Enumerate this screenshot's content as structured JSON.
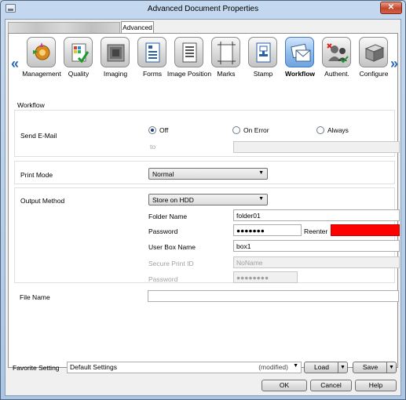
{
  "window": {
    "title": "Advanced Document Properties",
    "close_label": "✕"
  },
  "tabs": {
    "advanced_label": "Advanced"
  },
  "toolbar": {
    "items": [
      {
        "label": "Management",
        "icon": "management-gear-icon"
      },
      {
        "label": "Quality",
        "icon": "quality-icon"
      },
      {
        "label": "Imaging",
        "icon": "imaging-icon"
      },
      {
        "label": "Forms",
        "icon": "forms-icon"
      },
      {
        "label": "Image Position",
        "icon": "image-position-icon"
      },
      {
        "label": "Marks",
        "icon": "marks-icon"
      },
      {
        "label": "Stamp",
        "icon": "stamp-icon"
      },
      {
        "label": "Workflow",
        "icon": "workflow-icon",
        "active": true
      },
      {
        "label": "Authent.",
        "icon": "authentication-icon"
      },
      {
        "label": "Configure",
        "icon": "configure-icon"
      }
    ],
    "prev_glyph": "«",
    "next_glyph": "»"
  },
  "workflow": {
    "section_title": "Workflow",
    "send_email": {
      "label": "Send E-Mail",
      "options": [
        "Off",
        "On Error",
        "Always"
      ],
      "selected": "Off",
      "to_label": "to",
      "to_value": ""
    },
    "print_mode": {
      "label": "Print Mode",
      "value": "Normal"
    },
    "output_method": {
      "label": "Output Method",
      "value": "Store on HDD",
      "folder_name_label": "Folder Name",
      "folder_name_value": "folder01",
      "password_label": "Password",
      "password_value": "●●●●●●●",
      "reenter_label": "Reenter",
      "user_box_label": "User Box Name",
      "user_box_value": "box1",
      "secure_print_id_label": "Secure Print ID",
      "secure_print_id_value": "NoName",
      "secure_password_label": "Password",
      "secure_password_value": "●●●●●●●●"
    },
    "file_name": {
      "label": "File Name",
      "value": ""
    }
  },
  "favorite": {
    "label": "Favorite Setting",
    "value": "Default Settings",
    "modified_text": "(modified)",
    "load_label": "Load",
    "save_label": "Save"
  },
  "buttons": {
    "ok": "OK",
    "cancel": "Cancel",
    "help": "Help"
  },
  "colors": {
    "accent": "#3d7bc7",
    "error_field": "#ff0000"
  }
}
